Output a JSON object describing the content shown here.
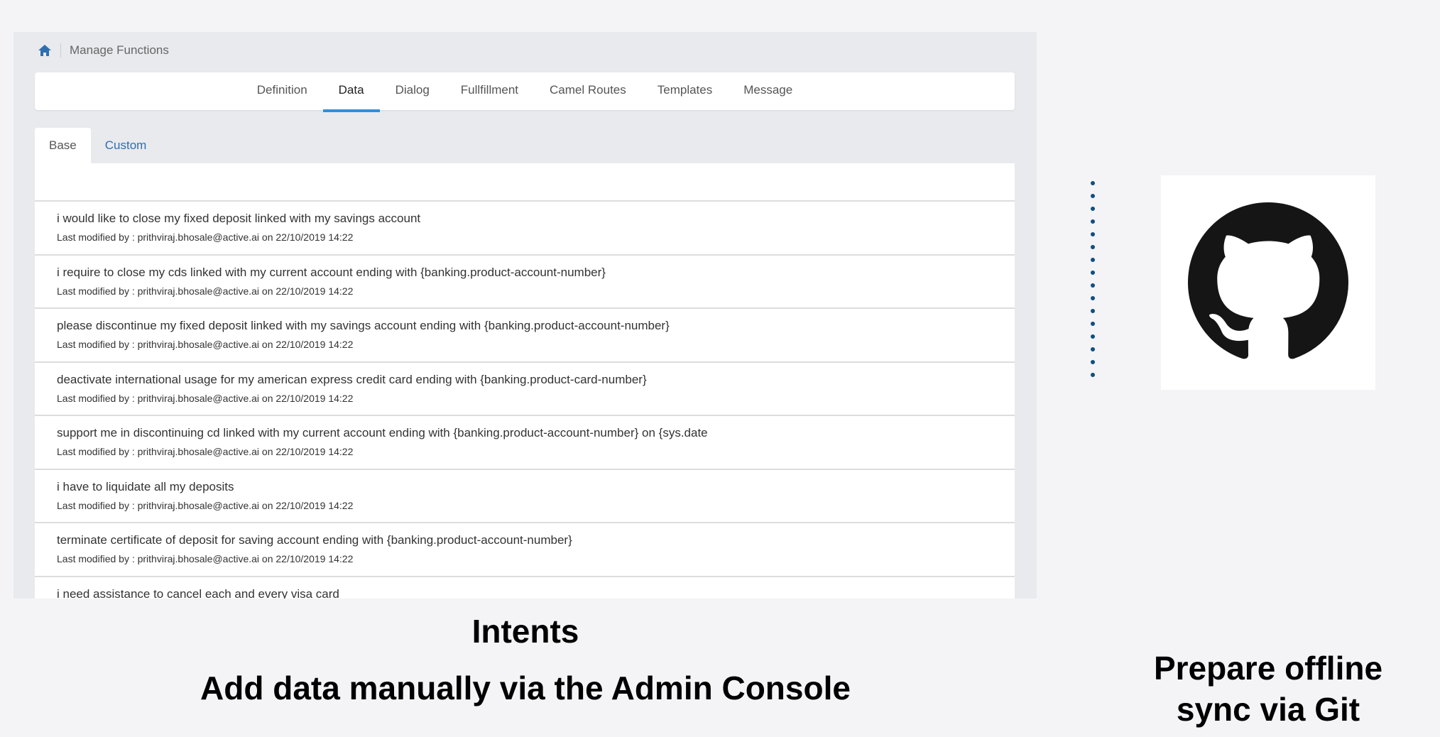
{
  "breadcrumb": {
    "home_icon": "home-icon",
    "title": "Manage Functions"
  },
  "tabs": [
    {
      "label": "Definition"
    },
    {
      "label": "Data",
      "active": true
    },
    {
      "label": "Dialog"
    },
    {
      "label": "Fullfillment"
    },
    {
      "label": "Camel Routes"
    },
    {
      "label": "Templates"
    },
    {
      "label": "Message"
    }
  ],
  "subtabs": [
    {
      "label": "Base",
      "active": true
    },
    {
      "label": "Custom"
    }
  ],
  "rows": [
    {
      "text": "i would like to close my fixed deposit linked with my savings account",
      "meta": "Last modified by : prithviraj.bhosale@active.ai on 22/10/2019 14:22"
    },
    {
      "text": "i require to close my cds linked with my current account ending with {banking.product-account-number}",
      "meta": "Last modified by : prithviraj.bhosale@active.ai on 22/10/2019 14:22"
    },
    {
      "text": "please discontinue my fixed deposit linked with my savings account ending with {banking.product-account-number}",
      "meta": "Last modified by : prithviraj.bhosale@active.ai on 22/10/2019 14:22"
    },
    {
      "text": "deactivate international usage for my american express credit card ending with {banking.product-card-number}",
      "meta": "Last modified by : prithviraj.bhosale@active.ai on 22/10/2019 14:22"
    },
    {
      "text": "support me in discontinuing cd linked with my current account ending with {banking.product-account-number} on {sys.date",
      "meta": "Last modified by : prithviraj.bhosale@active.ai on 22/10/2019 14:22"
    },
    {
      "text": "i have to liquidate all my deposits",
      "meta": "Last modified by : prithviraj.bhosale@active.ai on 22/10/2019 14:22"
    },
    {
      "text": "terminate certificate of deposit for saving account ending with {banking.product-account-number}",
      "meta": "Last modified by : prithviraj.bhosale@active.ai on 22/10/2019 14:22"
    },
    {
      "text": "i need assistance to cancel each and every visa card",
      "meta": ""
    }
  ],
  "captions": {
    "intents": "Intents",
    "manual": "Add data manually via the Admin Console",
    "git_line1": "Prepare offline",
    "git_line2": "sync via Git"
  },
  "colors": {
    "accent": "#2f8fdc",
    "dots": "#0f4f80"
  },
  "icons": {
    "github": "github-octocat-icon"
  }
}
